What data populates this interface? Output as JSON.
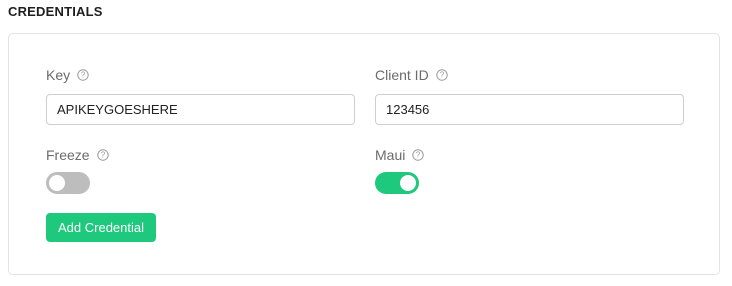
{
  "section": {
    "title": "CREDENTIALS"
  },
  "fields": {
    "key": {
      "label": "Key",
      "value": "APIKEYGOESHERE"
    },
    "client_id": {
      "label": "Client ID",
      "value": "123456"
    }
  },
  "toggles": {
    "freeze": {
      "label": "Freeze",
      "on": false
    },
    "maui": {
      "label": "Maui",
      "on": true
    }
  },
  "actions": {
    "add_label": "Add Credential"
  },
  "colors": {
    "accent": "#1ec97e",
    "toggle_off": "#bdbdbd",
    "label": "#6b6b6b",
    "border": "#cfcfcf"
  },
  "icons": {
    "help": "question-circle-icon"
  }
}
